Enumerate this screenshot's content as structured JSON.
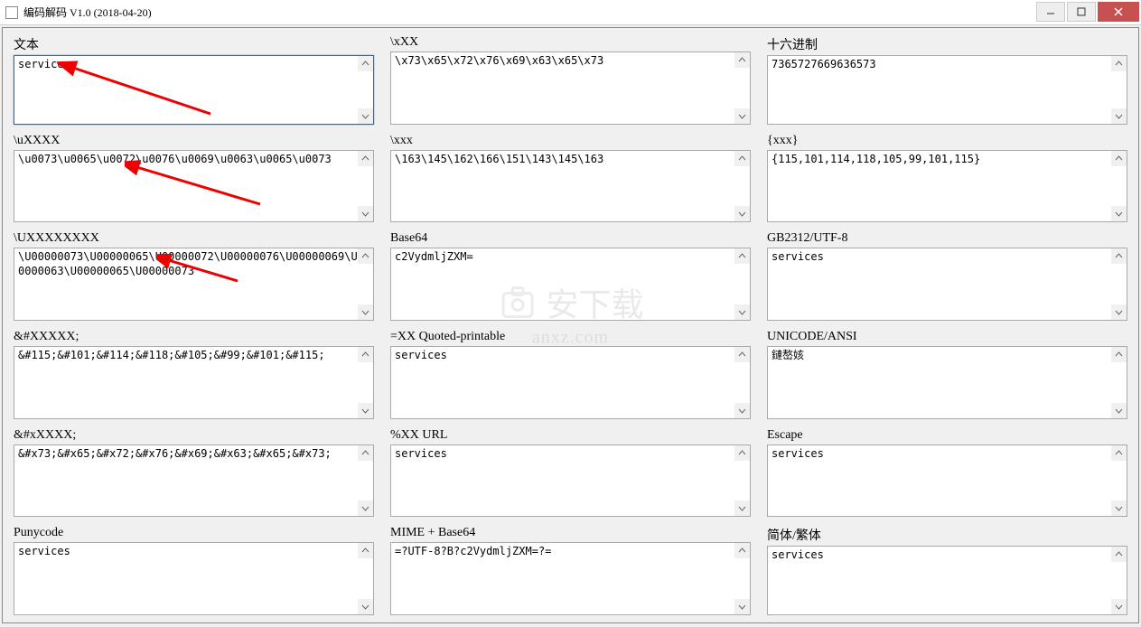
{
  "window": {
    "title": "编码解码 V1.0  (2018-04-20)"
  },
  "panels": [
    {
      "label": "文本",
      "value": "services"
    },
    {
      "label": "\\xXX",
      "value": "\\x73\\x65\\x72\\x76\\x69\\x63\\x65\\x73"
    },
    {
      "label": "十六进制",
      "value": "7365727669636573"
    },
    {
      "label": "\\uXXXX",
      "value": "\\u0073\\u0065\\u0072\\u0076\\u0069\\u0063\\u0065\\u0073"
    },
    {
      "label": "\\xxx",
      "value": "\\163\\145\\162\\166\\151\\143\\145\\163"
    },
    {
      "label": "{xxx}",
      "value": "{115,101,114,118,105,99,101,115}"
    },
    {
      "label": "\\UXXXXXXXX",
      "value": "\\U00000073\\U00000065\\U00000072\\U00000076\\U00000069\\U00000063\\U00000065\\U00000073"
    },
    {
      "label": "Base64",
      "value": "c2VydmljZXM="
    },
    {
      "label": "GB2312/UTF-8",
      "value": "services"
    },
    {
      "label": "&#XXXXX;",
      "value": "&#115;&#101;&#114;&#118;&#105;&#99;&#101;&#115;"
    },
    {
      "label": "=XX   Quoted-printable",
      "value": "services"
    },
    {
      "label": "UNICODE/ANSI",
      "value": "鏈嶅姟"
    },
    {
      "label": "&#xXXXX;",
      "value": "&#x73;&#x65;&#x72;&#x76;&#x69;&#x63;&#x65;&#x73;"
    },
    {
      "label": "%XX   URL",
      "value": "services"
    },
    {
      "label": "Escape",
      "value": "services"
    },
    {
      "label": "Punycode",
      "value": "services"
    },
    {
      "label": "MIME + Base64",
      "value": "=?UTF-8?B?c2VydmljZXM=?="
    },
    {
      "label": "简体/繁体",
      "value": "services"
    }
  ],
  "watermark": {
    "text": "安下载",
    "url": "anxz.com"
  }
}
